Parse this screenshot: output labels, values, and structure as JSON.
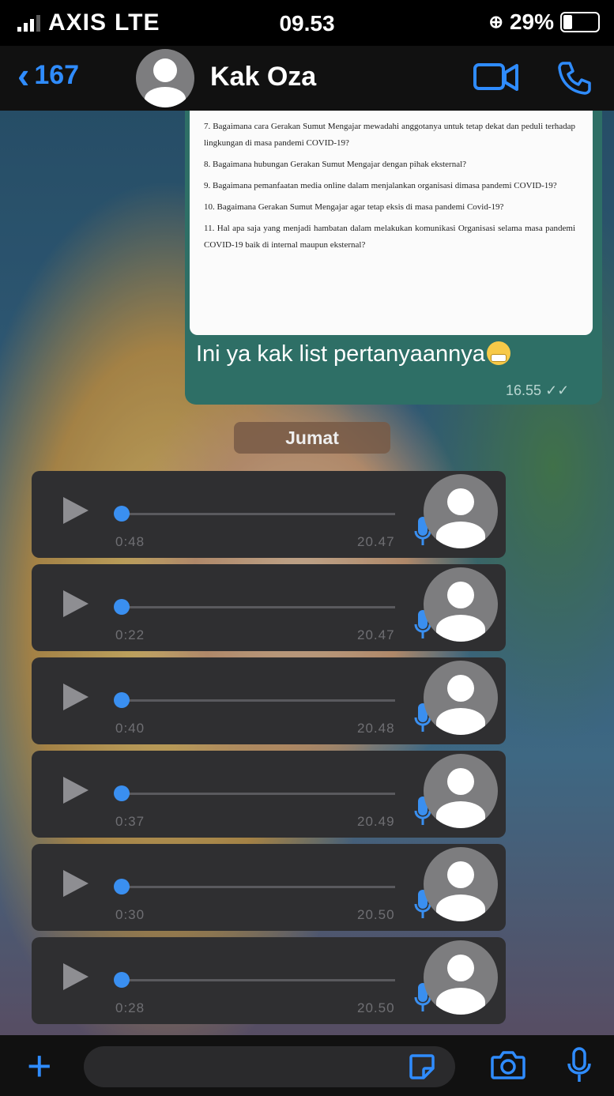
{
  "status_bar": {
    "carrier": "AXIS",
    "network": "LTE",
    "time": "09.53",
    "battery": "29%",
    "battery_level": 0.29
  },
  "header": {
    "back_count": "167",
    "contact_name": "Kak Oza"
  },
  "shared_document": {
    "questions": [
      "7. Bagaimana cara Gerakan Sumut Mengajar mewadahi anggotanya untuk tetap dekat dan peduli terhadap lingkungan di masa pandemi COVID-19?",
      "8. Bagaimana hubungan Gerakan Sumut Mengajar dengan pihak eksternal?",
      "9. Bagaimana pemanfaatan media online dalam menjalankan organisasi dimasa pandemi COVID-19?",
      "10. Bagaimana Gerakan Sumut Mengajar agar tetap eksis di masa pandemi Covid-19?",
      "11. Hal apa saja yang menjadi hambatan dalam melakukan komunikasi Organisasi selama masa pandemi COVID-19 baik di internal maupun eksternal?"
    ]
  },
  "outgoing_message": {
    "text": "Ini ya kak list pertanyaannya",
    "time": "16.55"
  },
  "day_separator": "Jumat",
  "voice_notes": [
    {
      "duration": "0:48",
      "time": "20.47"
    },
    {
      "duration": "0:22",
      "time": "20.47"
    },
    {
      "duration": "0:40",
      "time": "20.48"
    },
    {
      "duration": "0:37",
      "time": "20.49"
    },
    {
      "duration": "0:30",
      "time": "20.50"
    },
    {
      "duration": "0:28",
      "time": "20.50"
    }
  ],
  "colors": {
    "accent": "#2f8cff",
    "bubble_out": "#2e6f66",
    "voice_bg": "#2f2f31"
  },
  "icons": [
    "back-chevron-icon",
    "video-call-icon",
    "phone-icon",
    "play-icon",
    "microphone-icon",
    "plus-icon",
    "sticker-icon",
    "camera-icon"
  ]
}
